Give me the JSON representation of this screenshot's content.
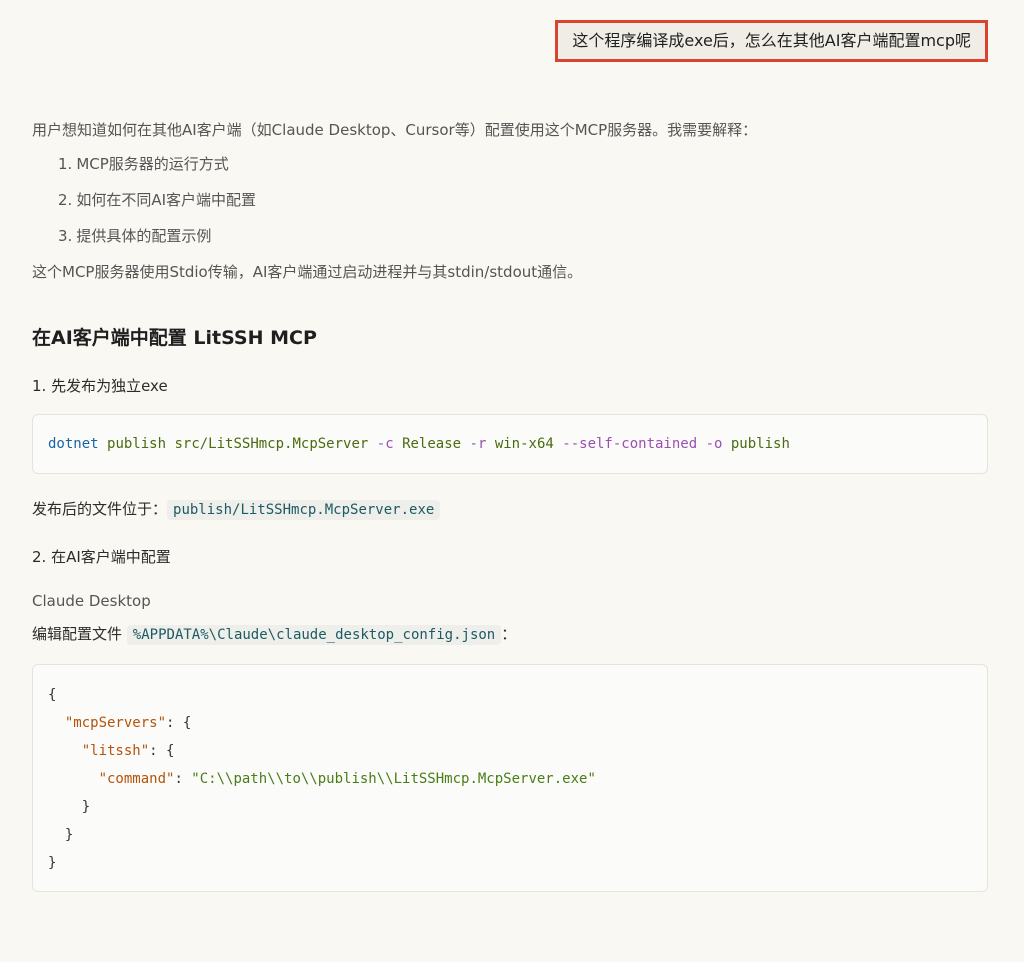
{
  "user_message": "这个程序编译成exe后，怎么在其他AI客户端配置mcp呢",
  "thinking": {
    "intro": "用户想知道如何在其他AI客户端（如Claude Desktop、Cursor等）配置使用这个MCP服务器。我需要解释：",
    "items": [
      {
        "num": "1.",
        "text": "MCP服务器的运行方式"
      },
      {
        "num": "2.",
        "text": "如何在不同AI客户端中配置"
      },
      {
        "num": "3.",
        "text": "提供具体的配置示例"
      }
    ],
    "summary": "这个MCP服务器使用Stdio传输，AI客户端通过启动进程并与其stdin/stdout通信。"
  },
  "section_heading": "在AI客户端中配置 LitSSH MCP",
  "step1": {
    "label": "1. 先发布为独立exe",
    "code": {
      "cmd": "dotnet",
      "sub": "publish",
      "path": "src/LitSSHmcp.McpServer",
      "flag_c": "-c",
      "val_c": "Release",
      "flag_r": "-r",
      "val_r": "win-x64",
      "flag_sc": "--self-contained",
      "flag_o": "-o",
      "val_o": "publish"
    },
    "published_prefix": "发布后的文件位于：",
    "published_path": "publish/LitSSHmcp.McpServer.exe"
  },
  "step2": {
    "label": "2. 在AI客户端中配置",
    "client_name": "Claude Desktop",
    "edit_prefix": "编辑配置文件",
    "config_path": "%APPDATA%\\Claude\\claude_desktop_config.json",
    "edit_suffix": "：",
    "json": {
      "open_brace": "{",
      "mcp_key": "\"mcpServers\"",
      "litssh_key": "\"litssh\"",
      "command_key": "\"command\"",
      "command_val": "\"C:\\\\path\\\\to\\\\publish\\\\LitSSHmcp.McpServer.exe\"",
      "close_brace": "}"
    }
  },
  "colors": {
    "background": "#faf8f2",
    "highlight_border": "#d9442f",
    "code_command": "#1a64a6",
    "code_flag": "#9b4fb0",
    "code_key": "#b45309",
    "code_string": "#4a7d16"
  }
}
